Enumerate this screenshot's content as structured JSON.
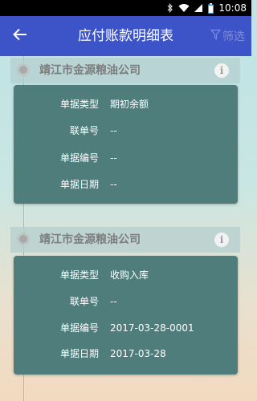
{
  "status_bar": {
    "time": "10:08"
  },
  "header": {
    "title": "应付账款明细表",
    "filter_label": "筛选"
  },
  "groups": [
    {
      "company": "靖江市金源粮油公司",
      "rows": [
        {
          "label": "单据类型",
          "value": "期初余额"
        },
        {
          "label": "联单号",
          "value": "--"
        },
        {
          "label": "单据编号",
          "value": "--"
        },
        {
          "label": "单据日期",
          "value": "--"
        }
      ]
    },
    {
      "company": "靖江市金源粮油公司",
      "rows": [
        {
          "label": "单据类型",
          "value": "收购入库"
        },
        {
          "label": "联单号",
          "value": "--"
        },
        {
          "label": "单据编号",
          "value": "2017-03-28-0001"
        },
        {
          "label": "单据日期",
          "value": "2017-03-28"
        }
      ]
    }
  ],
  "icons": {
    "back": "arrow-left-icon",
    "filter": "funnel-icon",
    "info": "info-icon"
  }
}
